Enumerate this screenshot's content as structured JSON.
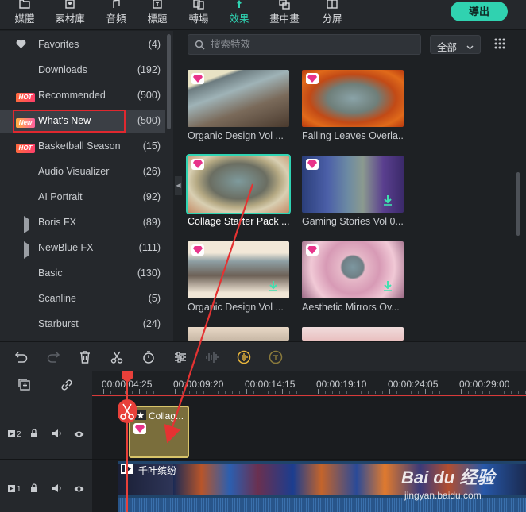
{
  "topbar": {
    "tabs": [
      {
        "label": "媒體",
        "icon": "folder-icon"
      },
      {
        "label": "素材庫",
        "icon": "stock-media-icon"
      },
      {
        "label": "音頻",
        "icon": "music-note-icon"
      },
      {
        "label": "標題",
        "icon": "title-text-icon"
      },
      {
        "label": "轉場",
        "icon": "transition-icon"
      },
      {
        "label": "效果",
        "icon": "effects-pin-icon"
      },
      {
        "label": "畫中畫",
        "icon": "pip-icon"
      },
      {
        "label": "分屏",
        "icon": "split-screen-icon"
      }
    ],
    "active_tab": "效果",
    "export_label": "導出",
    "accent_color": "#30d2b0"
  },
  "sidebar": {
    "items": [
      {
        "label": "Favorites",
        "count": "(4)",
        "icon": "heart-icon",
        "badge": ""
      },
      {
        "label": "Downloads",
        "count": "(192)",
        "icon": "",
        "badge": ""
      },
      {
        "label": "Recommended",
        "count": "(500)",
        "icon": "",
        "badge": "HOT"
      },
      {
        "label": "What's New",
        "count": "(500)",
        "icon": "",
        "badge": "New"
      },
      {
        "label": "Basketball Season",
        "count": "(15)",
        "icon": "",
        "badge": "HOT"
      },
      {
        "label": "Audio Visualizer",
        "count": "(26)",
        "icon": "",
        "badge": ""
      },
      {
        "label": "AI Portrait",
        "count": "(92)",
        "icon": "",
        "badge": ""
      },
      {
        "label": "Boris FX",
        "count": "(89)",
        "icon": "expand-triangle-icon",
        "badge": ""
      },
      {
        "label": "NewBlue FX",
        "count": "(111)",
        "icon": "expand-triangle-icon",
        "badge": ""
      },
      {
        "label": "Basic",
        "count": "(130)",
        "icon": "",
        "badge": ""
      },
      {
        "label": "Scanline",
        "count": "(5)",
        "icon": "",
        "badge": ""
      },
      {
        "label": "Starburst",
        "count": "(24)",
        "icon": "",
        "badge": ""
      }
    ],
    "selected": "What's New"
  },
  "effects": {
    "search_placeholder": "搜索特效",
    "filter_value": "全部",
    "cards": [
      {
        "name": "Organic Design Vol ...",
        "download": false
      },
      {
        "name": "Falling Leaves Overla...",
        "download": false
      },
      {
        "name": "Collage Starter Pack ...",
        "download": false,
        "selected": true
      },
      {
        "name": "Gaming Stories Vol 0...",
        "download": true
      },
      {
        "name": "Organic Design Vol ...",
        "download": true
      },
      {
        "name": "Aesthetic Mirrors Ov...",
        "download": true
      }
    ]
  },
  "timeline": {
    "timecodes": [
      "00:00:04:25",
      "00:00:09:20",
      "00:00:14:15",
      "00:00:19:10",
      "00:00:24:05",
      "00:00:29:00"
    ],
    "tracks": [
      {
        "number": "2"
      },
      {
        "number": "1"
      }
    ],
    "effect_clip_name": "Collag...",
    "video_clip_name": "千叶缤纷",
    "playhead_color": "#e8403a"
  },
  "watermark": {
    "main": "Bai du 经验",
    "sub": "jingyan.baidu.com"
  }
}
